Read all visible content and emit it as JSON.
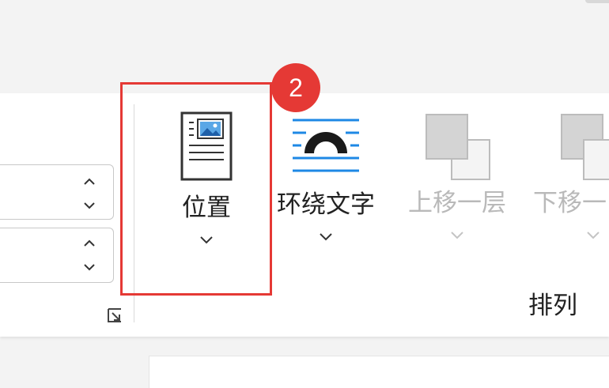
{
  "ribbon": {
    "group_label": "排列",
    "commands": {
      "position": {
        "label": "位置",
        "icon": "position-icon",
        "enabled": true
      },
      "wrap_text": {
        "label": "环绕文字",
        "icon": "wrap-text-icon",
        "enabled": true
      },
      "bring_forward": {
        "label": "上移一层",
        "icon": "bring-forward-icon",
        "enabled": false
      },
      "send_backward": {
        "label": "下移一",
        "icon": "send-backward-icon",
        "enabled": false
      }
    }
  },
  "annotation": {
    "step_number": "2",
    "highlight_color": "#e53935"
  },
  "colors": {
    "accent_blue": "#1e88e5",
    "disabled_text": "#b9b9b9"
  }
}
